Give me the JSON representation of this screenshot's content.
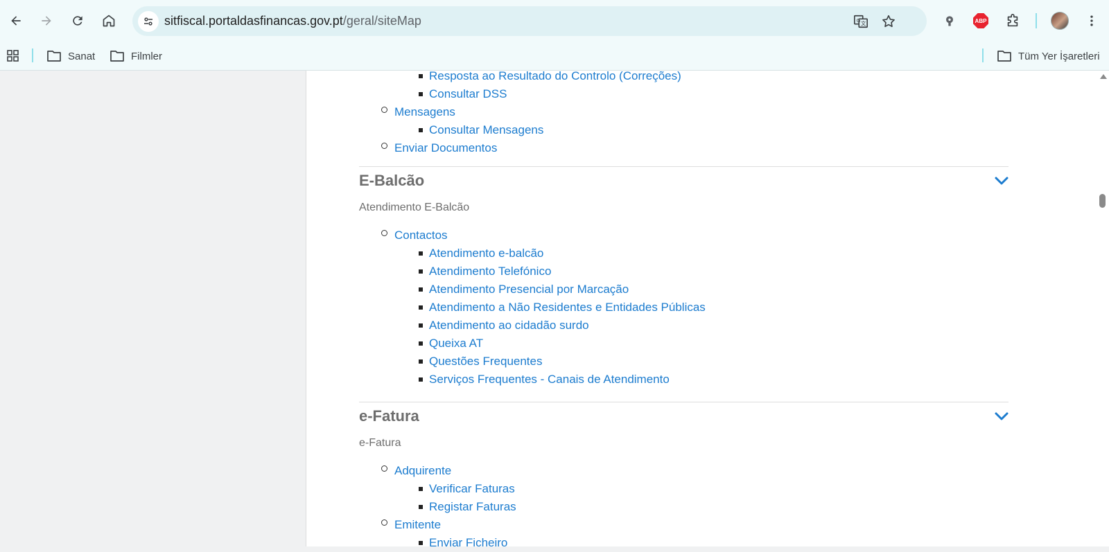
{
  "browser": {
    "url_host": "sitfiscal.portaldasfinancas.gov.pt",
    "url_path": "/geral/siteMap",
    "extension_abp_label": "ABP"
  },
  "bookmarks": {
    "items": [
      {
        "label": "Sanat"
      },
      {
        "label": "Filmler"
      }
    ],
    "all_bookmarks_label": "Tüm Yer İşaretleri"
  },
  "sitemap": {
    "top_items": [
      {
        "label": "Resposta ao Resultado do Controlo (Correções)",
        "level": 2
      },
      {
        "label": "Consultar DSS",
        "level": 2
      },
      {
        "label": "Mensagens",
        "level": 1
      },
      {
        "label": "Consultar Mensagens",
        "level": 2
      },
      {
        "label": "Enviar Documentos",
        "level": 1
      }
    ],
    "sections": [
      {
        "title": "E-Balcão",
        "subtitle": "Atendimento E-Balcão",
        "items": [
          {
            "label": "Contactos",
            "level": 1
          },
          {
            "label": "Atendimento e-balcão",
            "level": 2
          },
          {
            "label": "Atendimento Telefónico",
            "level": 2
          },
          {
            "label": "Atendimento Presencial por Marcação",
            "level": 2
          },
          {
            "label": "Atendimento a Não Residentes e Entidades Públicas",
            "level": 2
          },
          {
            "label": "Atendimento ao cidadão surdo",
            "level": 2
          },
          {
            "label": "Queixa AT",
            "level": 2
          },
          {
            "label": "Questões Frequentes",
            "level": 2
          },
          {
            "label": "Serviços Frequentes - Canais de Atendimento",
            "level": 2
          }
        ]
      },
      {
        "title": "e-Fatura",
        "subtitle": "e-Fatura",
        "items": [
          {
            "label": "Adquirente",
            "level": 1
          },
          {
            "label": "Verificar Faturas",
            "level": 2
          },
          {
            "label": "Registar Faturas",
            "level": 2
          },
          {
            "label": "Emitente",
            "level": 1
          },
          {
            "label": "Enviar Ficheiro",
            "level": 2
          }
        ]
      }
    ]
  },
  "colors": {
    "link": "#1c7ccf",
    "heading": "#6d6d6d",
    "chrome_bg": "#f1fafb",
    "omnibox_bg": "#dff1f4"
  }
}
